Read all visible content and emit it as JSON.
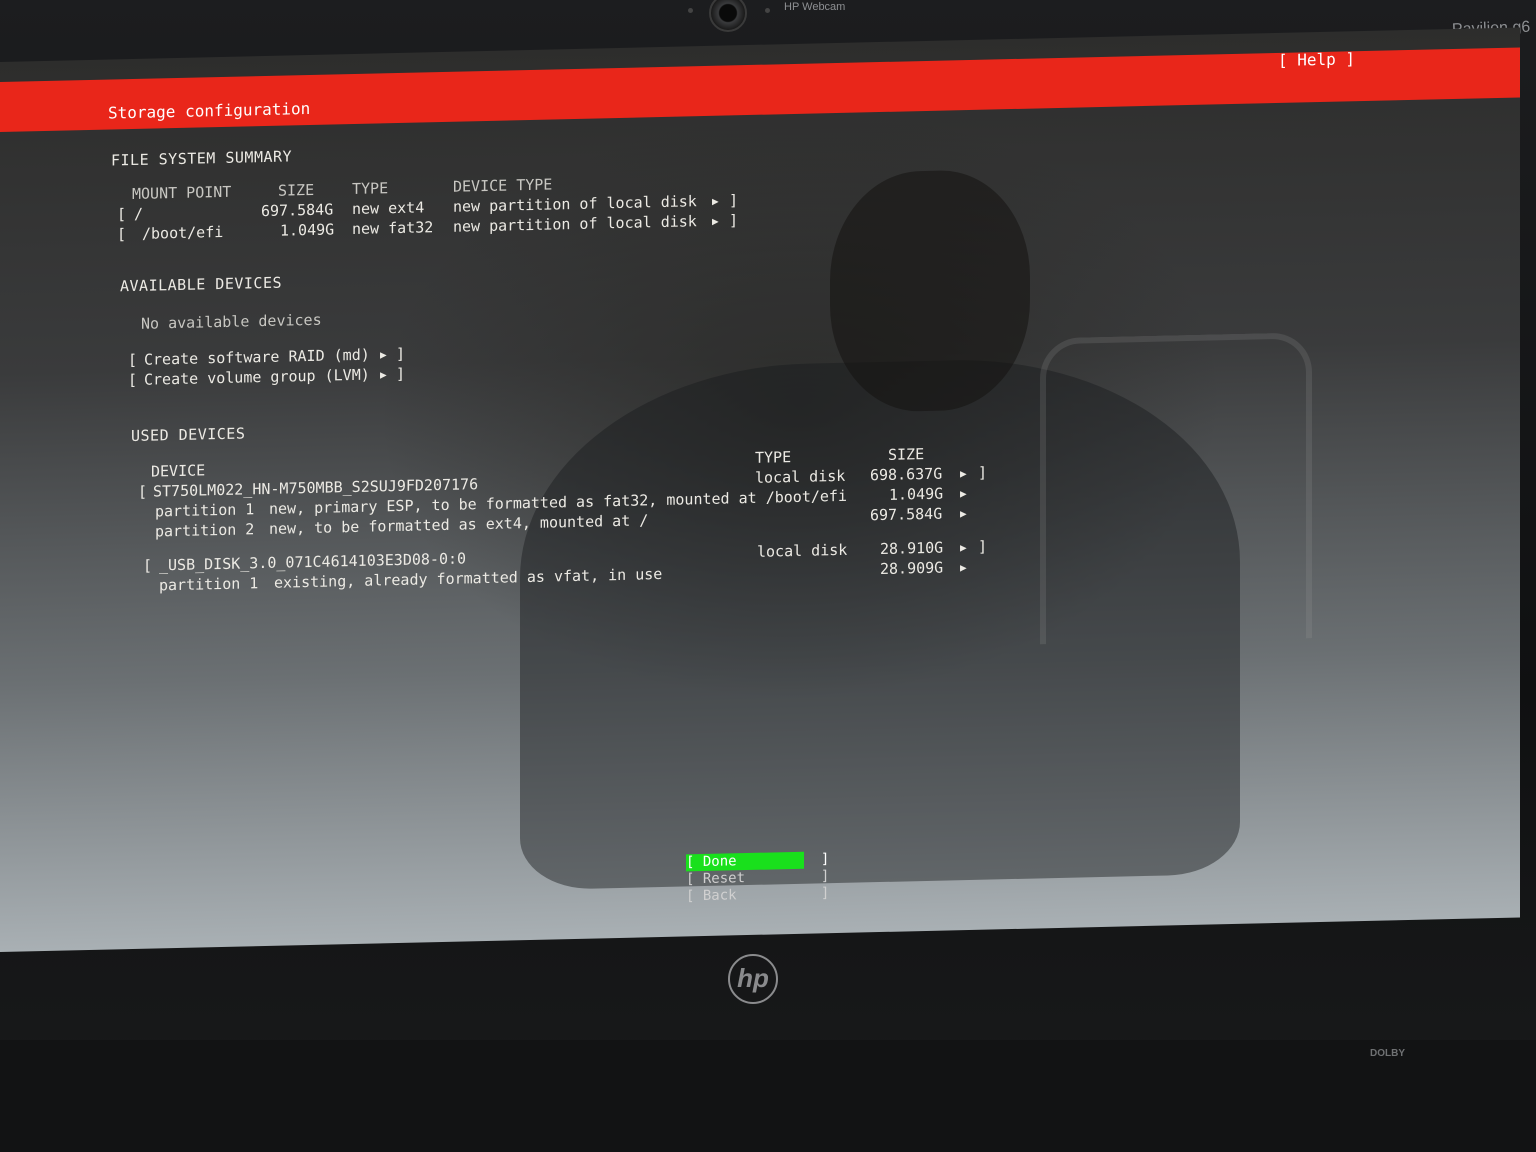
{
  "hardware": {
    "webcam_label": "HP Webcam",
    "model_label": "Pavilion g6",
    "logo": "hp",
    "dolby_label": "DOLBY"
  },
  "header": {
    "title": "Storage configuration",
    "help_label": "[ Help ]",
    "bar_color": "#e9261a"
  },
  "fs_summary": {
    "heading": "FILE SYSTEM SUMMARY",
    "columns": {
      "mount": "MOUNT POINT",
      "size": "SIZE",
      "type": "TYPE",
      "device_type": "DEVICE TYPE"
    },
    "rows": [
      {
        "bracket": "[",
        "mount": "/",
        "size": "697.584G",
        "type": "new ext4",
        "device_type": "new partition of local disk",
        "close": "]"
      },
      {
        "bracket": "[",
        "mount": "/boot/efi",
        "size": "1.049G",
        "type": "new fat32",
        "device_type": "new partition of local disk",
        "close": "]"
      }
    ]
  },
  "available": {
    "heading": "AVAILABLE DEVICES",
    "empty_text": "No available devices",
    "actions": [
      "Create software RAID (md)",
      "Create volume group (LVM)"
    ]
  },
  "used": {
    "heading": "USED DEVICES",
    "columns": {
      "device": "DEVICE",
      "type": "TYPE",
      "size": "SIZE"
    },
    "disks": [
      {
        "name": "ST750LM022_HN-M750MBB_S2SUJ9FD207176",
        "type": "local disk",
        "size": "698.637G",
        "partitions": [
          {
            "label": "partition 1",
            "desc": "new, primary ESP, to be formatted as fat32, mounted at /boot/efi",
            "size": "1.049G"
          },
          {
            "label": "partition 2",
            "desc": "new, to be formatted as ext4, mounted at /",
            "size": "697.584G"
          }
        ]
      },
      {
        "name": "_USB_DISK_3.0_071C4614103E3D08-0:0",
        "type": "local disk",
        "size": "28.910G",
        "partitions": [
          {
            "label": "partition 1",
            "desc": "existing, already formatted as vfat, in use",
            "size": "28.909G"
          }
        ]
      }
    ]
  },
  "buttons": {
    "done": "[ Done          ]",
    "reset": "[ Reset         ]",
    "back": "[ Back          ]",
    "focus_color": "#19e01c"
  },
  "icons": {
    "expand": "▶"
  }
}
